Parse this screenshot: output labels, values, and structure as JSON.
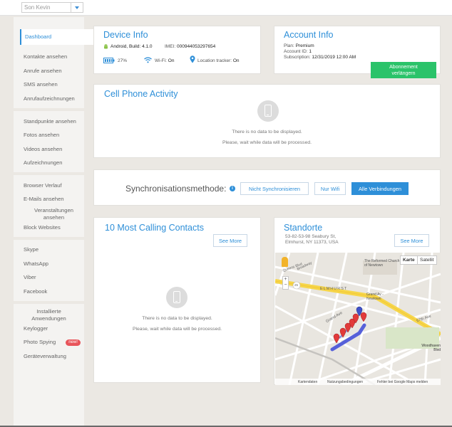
{
  "topbar": {
    "user_select": "Son Kevin"
  },
  "sidebar": {
    "active": "Dashboard",
    "items": [
      "Kontakte ansehen",
      "Anrufe ansehen",
      "SMS ansehen",
      "Anrufaufzeichnungen",
      "Standpunkte ansehen",
      "Fotos ansehen",
      "Videos ansehen",
      "Aufzeichnungen",
      "Browser Verlauf",
      "E-Mails ansehen",
      "Veranstaltungen ansehen",
      "Block Websites",
      "Skype",
      "WhatsApp",
      "Viber",
      "Facebook",
      "Installierte Anwendungen",
      "Keylogger",
      "Photo Spying",
      "Geräteverwaltung"
    ],
    "new_badge": "new!"
  },
  "device_info": {
    "title": "Device Info",
    "os_label": "Android, Build:",
    "build": "4.1.0",
    "imei_label": "IMEI:",
    "imei": "000944053297654",
    "battery": "27%",
    "wifi_label": "Wi-Fi:",
    "wifi": "On",
    "location_label": "Location tracker:",
    "location": "On"
  },
  "account_info": {
    "title": "Account Info",
    "plan_label": "Plan:",
    "plan": "Premium",
    "account_id_label": "Account ID:",
    "account_id": "1",
    "subscription_label": "Subscription:",
    "subscription": "12/31/2019 12:00 AM",
    "renew_line1": "Abonnement",
    "renew_line2": "verlängern"
  },
  "activity": {
    "title": "Cell Phone Activity",
    "empty_line1": "There is no data to be displayed.",
    "empty_line2": "Please, wait while data will be processed."
  },
  "sync": {
    "title": "Synchronisationsmethode:",
    "info": "i",
    "options": [
      "Nicht Synchronisieren",
      "Nur Wifi",
      "Alle Verbindungen"
    ],
    "selected": "Alle Verbindungen"
  },
  "contacts": {
    "title": "10 Most Calling Contacts",
    "see_more": "See More",
    "empty_line1": "There is no data to be displayed.",
    "empty_line2": "Please, wait while data will be processed."
  },
  "locations": {
    "title": "Standorte",
    "address_line1": "53-82-53-98 Seabury St,",
    "address_line2": "Elmhurst, NY 11373, USA",
    "see_more": "See More",
    "map_type_karte": "Karte",
    "map_type_satellit": "Satellit",
    "map_labels": [
      "Grand Ave",
      "Grand Av - Newtown",
      "ELMHURST",
      "The Reformed Church of Newtown",
      "Queens Blvd",
      "57th Ave",
      "Woodhaven Blvd",
      "Broadway",
      "25"
    ],
    "footer": [
      "Kartendaten",
      "Nutzungsbedingungen",
      "Fehler bei Google Maps melden"
    ]
  },
  "colors": {
    "accent": "#2e8fd8",
    "renew": "#2bc36a",
    "pin": "#e23a3a",
    "pin_last": "#3f52c9"
  }
}
